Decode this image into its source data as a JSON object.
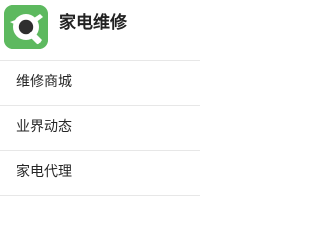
{
  "header": {
    "title": "家电维修",
    "logo_icon": "wrench-icon",
    "brand_color": "#5db95f"
  },
  "menu": {
    "items": [
      {
        "label": "维修商城"
      },
      {
        "label": "业界动态"
      },
      {
        "label": "家电代理"
      }
    ]
  }
}
